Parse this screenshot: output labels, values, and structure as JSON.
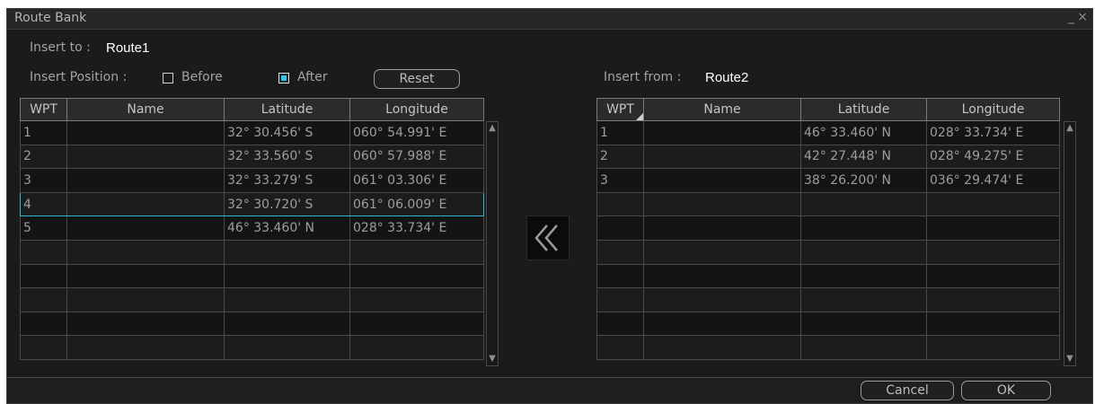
{
  "dialog": {
    "title": "Route Bank",
    "minimize_glyph": "_",
    "close_glyph": "×"
  },
  "insert_to": {
    "label": "Insert to :",
    "value": "Route1"
  },
  "insert_position": {
    "label": "Insert Position :",
    "before_label": "Before",
    "after_label": "After",
    "selected": "After",
    "reset_label": "Reset"
  },
  "insert_from": {
    "label": "Insert from :",
    "value": "Route2"
  },
  "columns": [
    "WPT",
    "Name",
    "Latitude",
    "Longitude"
  ],
  "left_table": {
    "rows": [
      {
        "wpt": "1",
        "name": "",
        "lat": "32° 30.456' S",
        "lon": "060° 54.991' E"
      },
      {
        "wpt": "2",
        "name": "",
        "lat": "32° 33.560' S",
        "lon": "060° 57.988' E"
      },
      {
        "wpt": "3",
        "name": "",
        "lat": "32° 33.279' S",
        "lon": "061° 03.306' E"
      },
      {
        "wpt": "4",
        "name": "",
        "lat": "32° 30.720' S",
        "lon": "061° 06.009' E"
      },
      {
        "wpt": "5",
        "name": "",
        "lat": "46° 33.460' N",
        "lon": "028° 33.734' E"
      },
      {
        "wpt": "",
        "name": "",
        "lat": "",
        "lon": ""
      },
      {
        "wpt": "",
        "name": "",
        "lat": "",
        "lon": ""
      },
      {
        "wpt": "",
        "name": "",
        "lat": "",
        "lon": ""
      },
      {
        "wpt": "",
        "name": "",
        "lat": "",
        "lon": ""
      },
      {
        "wpt": "",
        "name": "",
        "lat": "",
        "lon": ""
      }
    ],
    "selected_wpt": "4"
  },
  "right_table": {
    "rows": [
      {
        "wpt": "1",
        "name": "",
        "lat": "46° 33.460' N",
        "lon": "028° 33.734' E"
      },
      {
        "wpt": "2",
        "name": "",
        "lat": "42° 27.448' N",
        "lon": "028° 49.275' E"
      },
      {
        "wpt": "3",
        "name": "",
        "lat": "38° 26.200' N",
        "lon": "036° 29.474' E"
      },
      {
        "wpt": "",
        "name": "",
        "lat": "",
        "lon": ""
      },
      {
        "wpt": "",
        "name": "",
        "lat": "",
        "lon": ""
      },
      {
        "wpt": "",
        "name": "",
        "lat": "",
        "lon": ""
      },
      {
        "wpt": "",
        "name": "",
        "lat": "",
        "lon": ""
      },
      {
        "wpt": "",
        "name": "",
        "lat": "",
        "lon": ""
      },
      {
        "wpt": "",
        "name": "",
        "lat": "",
        "lon": ""
      },
      {
        "wpt": "",
        "name": "",
        "lat": "",
        "lon": ""
      }
    ]
  },
  "transfer_icon": "double-chevron-left-icon",
  "footer": {
    "cancel_label": "Cancel",
    "ok_label": "OK"
  },
  "colors": {
    "background": "#1b1b1b",
    "selection_border": "#2fb6cf",
    "radio_fill": "#39c4e6",
    "value_text": "#ffffff"
  }
}
